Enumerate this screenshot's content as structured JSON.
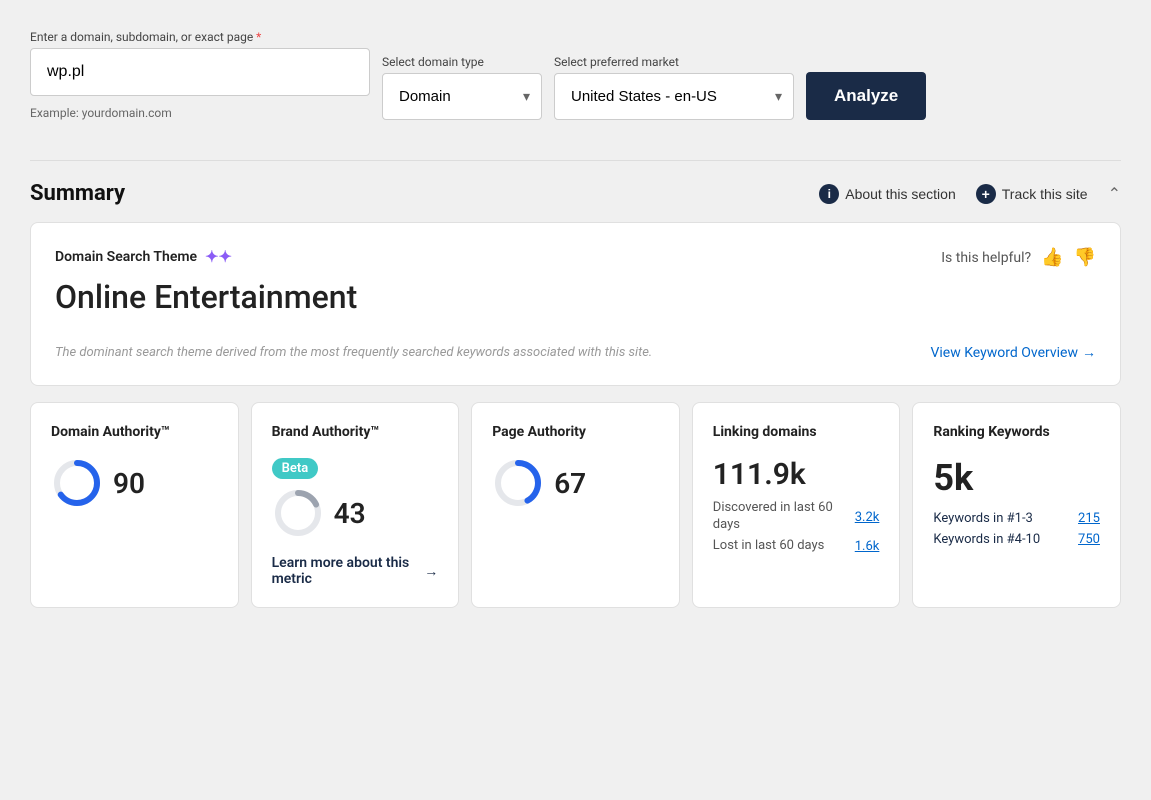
{
  "header": {
    "domain_label": "Enter a domain, subdomain, or exact page",
    "required_star": "*",
    "domain_placeholder": "wp.pl",
    "domain_example": "Example: yourdomain.com",
    "domain_type_label": "Select domain type",
    "domain_type_value": "Domain",
    "market_label": "Select preferred market",
    "market_value": "United States - en-US",
    "analyze_label": "Analyze"
  },
  "summary": {
    "title": "Summary",
    "about_label": "About this section",
    "track_label": "Track this site"
  },
  "domain_theme_card": {
    "label": "Domain Search Theme",
    "sparkle": "✦✦",
    "title": "Online Entertainment",
    "subtitle": "The dominant search theme derived from the most frequently searched keywords associated with this site.",
    "helpful_label": "Is this helpful?",
    "view_keyword_label": "View Keyword Overview",
    "arrow": "→"
  },
  "metrics": {
    "domain_authority": {
      "title": "Domain Authority™",
      "value": "90",
      "donut_pct": 90,
      "color": "#2563eb"
    },
    "brand_authority": {
      "title": "Brand Authority™",
      "beta_label": "Beta",
      "value": "43",
      "donut_pct": 43,
      "color": "#9ca3af",
      "learn_more": "Learn more about this metric",
      "arrow": "→"
    },
    "page_authority": {
      "title": "Page Authority",
      "value": "67",
      "donut_pct": 67,
      "color": "#2563eb"
    },
    "linking_domains": {
      "title": "Linking domains",
      "value": "111.9k",
      "discovered_label": "Discovered in last 60 days",
      "discovered_value": "3.2k",
      "lost_label": "Lost in last 60 days",
      "lost_value": "1.6k"
    },
    "ranking_keywords": {
      "title": "Ranking Keywords",
      "value": "5k",
      "kw1_label": "Keywords in #1-3",
      "kw1_value": "215",
      "kw4_label": "Keywords in #4-10",
      "kw4_value": "750"
    }
  }
}
